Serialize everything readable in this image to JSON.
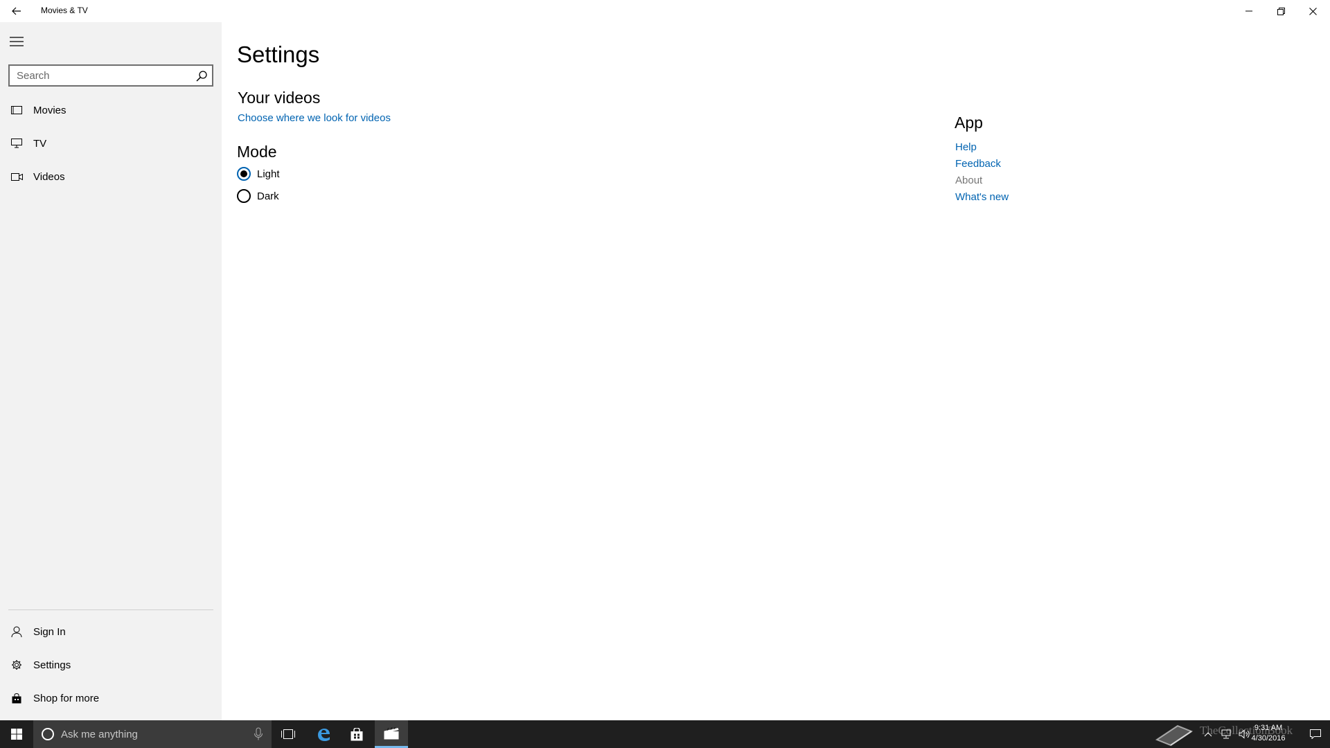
{
  "window": {
    "title": "Movies & TV"
  },
  "sidebar": {
    "search_placeholder": "Search",
    "nav": [
      {
        "label": "Movies",
        "icon": "film-icon"
      },
      {
        "label": "TV",
        "icon": "tv-icon"
      },
      {
        "label": "Videos",
        "icon": "video-camera-icon"
      }
    ],
    "bottom": [
      {
        "label": "Sign In",
        "icon": "person-icon"
      },
      {
        "label": "Settings",
        "icon": "gear-icon"
      },
      {
        "label": "Shop for more",
        "icon": "store-bag-icon"
      }
    ]
  },
  "main": {
    "title": "Settings",
    "your_videos": {
      "heading": "Your videos",
      "link": "Choose where we look for videos"
    },
    "mode": {
      "heading": "Mode",
      "options": [
        {
          "label": "Light",
          "selected": true
        },
        {
          "label": "Dark",
          "selected": false
        }
      ]
    },
    "app": {
      "heading": "App",
      "links": [
        {
          "label": "Help",
          "active": true
        },
        {
          "label": "Feedback",
          "active": true
        },
        {
          "label": "About",
          "active": false
        },
        {
          "label": "What's new",
          "active": true
        }
      ]
    }
  },
  "taskbar": {
    "search_text": "Ask me anything",
    "time": "9:31 AM",
    "date": "4/30/2016",
    "watermark_text": "TheCollectionBook",
    "accent_color": "#76b9ed"
  },
  "colors": {
    "link": "#0063b1",
    "sidebar_bg": "#f2f2f2",
    "taskbar_bg": "#1f1f1f"
  }
}
